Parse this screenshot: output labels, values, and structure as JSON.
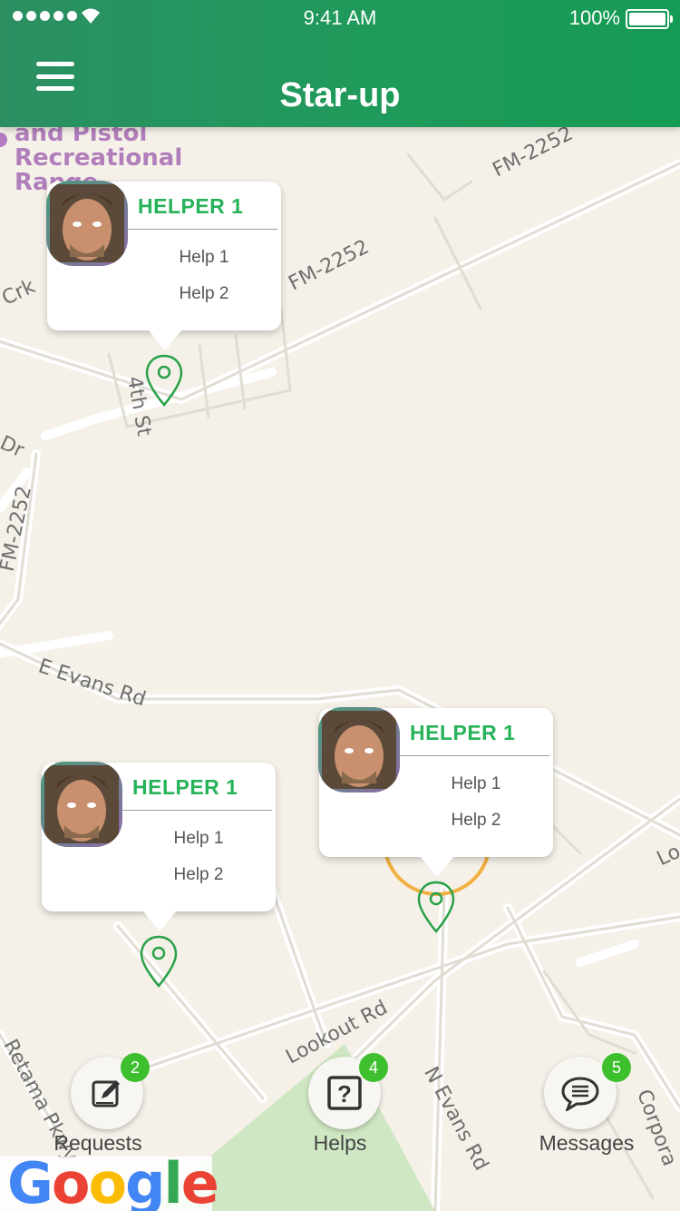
{
  "status_bar": {
    "time": "9:41 AM",
    "battery": "100%"
  },
  "header": {
    "title": "Star-up",
    "menu_icon": "hamburger-icon"
  },
  "map": {
    "labels": {
      "poi": "and Pistol\nRecreational\nRange",
      "fm2252_top": "FM-2252",
      "fm2252_mid": "FM-2252",
      "fm2252_left": "FM-2252",
      "crk": "Crk",
      "fourth_st": "4th St",
      "dr": "Dr",
      "evans": "E Evans Rd",
      "lookout": "Lookout Rd",
      "n_evans": "N Evans Rd",
      "retama": "Retama Pkwy",
      "corporate": "Corpora",
      "lo": "Lo"
    }
  },
  "helpers": [
    {
      "name": "HELPER 1",
      "help1": "Help 1",
      "help2": "Help 2"
    },
    {
      "name": "HELPER 1",
      "help1": "Help 1",
      "help2": "Help 2"
    },
    {
      "name": "HELPER 1",
      "help1": "Help 1",
      "help2": "Help 2"
    }
  ],
  "nav": {
    "requests": {
      "label": "Requests",
      "badge": "2",
      "icon": "edit-icon"
    },
    "helps": {
      "label": "Helps",
      "badge": "4",
      "icon": "question-icon"
    },
    "messages": {
      "label": "Messages",
      "badge": "5",
      "icon": "chat-icon"
    }
  },
  "google_logo": "Google",
  "colors": {
    "header_green": "#1f9a5a",
    "accent_green": "#27b35a",
    "badge_green": "#3ec02e"
  }
}
